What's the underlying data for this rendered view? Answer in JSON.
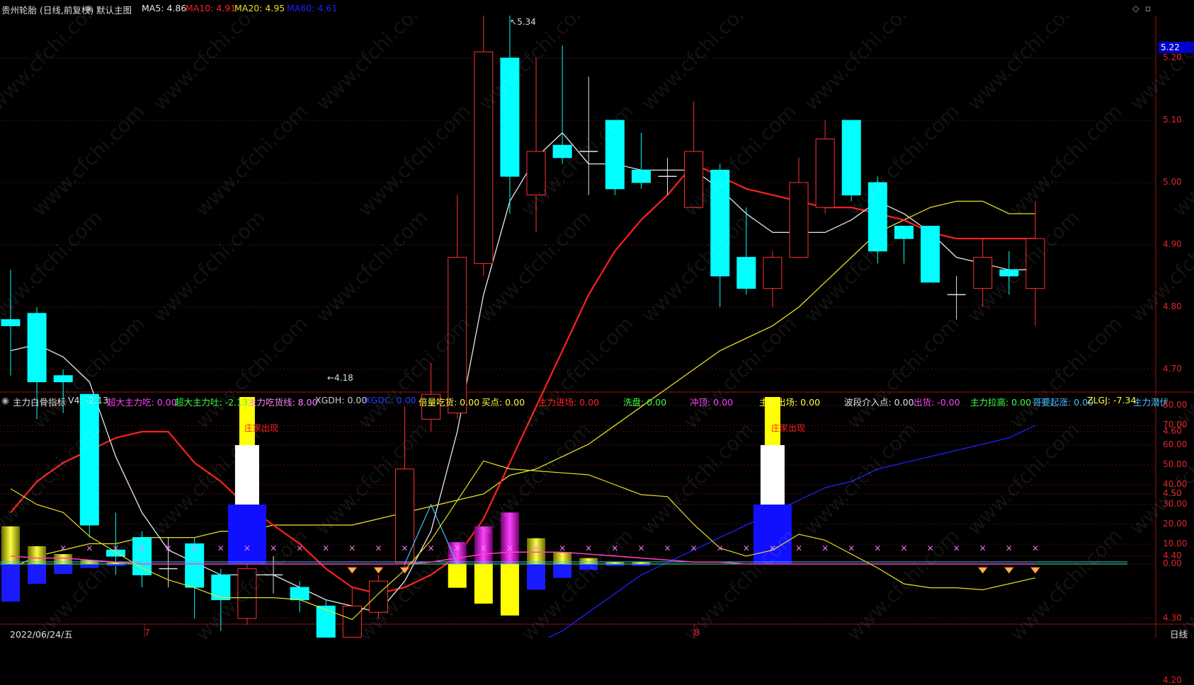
{
  "header": {
    "stock_title": "贵州轮胎 (日线,前复权)",
    "main_chart_label": "默认主图",
    "ma5_label": "MA5: 4.86",
    "ma10_label": "MA10: 4.91",
    "ma20_label": "MA20: 4.95",
    "ma60_label": "MA60: 4.61",
    "colors": {
      "ma5": "#e8e8e8",
      "ma10": "#ff2020",
      "ma20": "#e8e020",
      "ma60": "#2020ff"
    }
  },
  "price_axis": {
    "current_price": "5.22",
    "ticks": [
      "5.20",
      "5.10",
      "5.00",
      "4.90",
      "4.80",
      "4.70",
      "4.60",
      "4.50",
      "4.40",
      "4.30",
      "4.20"
    ]
  },
  "annotations": {
    "high_label": "5.34",
    "low_label": "←4.18"
  },
  "indicator": {
    "name": "主力白骨指标",
    "v4": "V4: -2.13",
    "items": [
      {
        "label": "超大主力吃: 0.00",
        "color": "#ff40ff"
      },
      {
        "label": "超大主力吐: -2.13",
        "color": "#40ff40"
      },
      {
        "label": "主力吃货线: 8.00",
        "color": "#ff80ff"
      },
      {
        "label": "XGDH: 0.00",
        "color": "#d0d0d0"
      },
      {
        "label": "XGDC: 0.00",
        "color": "#2040ff"
      },
      {
        "label": "倍量吃货: 0.00",
        "color": "#ffff40"
      },
      {
        "label": "买点: 0.00",
        "color": "#ffff40"
      },
      {
        "label": "主力进场: 0.00",
        "color": "#ff2020"
      },
      {
        "label": "洗盘: 0.00",
        "color": "#40ff40"
      },
      {
        "label": "冲顶: 0.00",
        "color": "#ff40ff"
      },
      {
        "label": "主力出场: 0.00",
        "color": "#ffff40"
      },
      {
        "label": "波段介入点: 0.00",
        "color": "#e0e0e0"
      },
      {
        "label": "出货: -0.00",
        "color": "#ff40ff"
      },
      {
        "label": "主力拉高: 0.00",
        "color": "#40ff40"
      },
      {
        "label": "哥要起涨: 0.00",
        "color": "#40c0ff"
      },
      {
        "label": "ZLGJ: -7.34",
        "color": "#ffff40"
      },
      {
        "label": "主力潜伏",
        "color": "#40c0ff"
      }
    ],
    "zj_label": "庄家出现",
    "axis_ticks": [
      "80.00",
      "70.00",
      "60.00",
      "50.00",
      "40.00",
      "30.00",
      "20.00",
      "10.00",
      "0.00"
    ]
  },
  "bottom_bar": {
    "date": "2022/06/24/五",
    "month_7": "7",
    "month_8": "8",
    "period": "日线"
  },
  "watermark": "www.cfchi.com",
  "chart_data": {
    "type": "candlestick",
    "candles": [
      {
        "o": 4.78,
        "c": 4.77,
        "h": 4.86,
        "l": 4.69
      },
      {
        "o": 4.79,
        "c": 4.68,
        "h": 4.8,
        "l": 4.62
      },
      {
        "o": 4.69,
        "c": 4.68,
        "h": 4.7,
        "l": 4.63
      },
      {
        "o": 4.66,
        "c": 4.45,
        "h": 4.66,
        "l": 4.43
      },
      {
        "o": 4.41,
        "c": 4.4,
        "h": 4.47,
        "l": 4.37
      },
      {
        "o": 4.43,
        "c": 4.37,
        "h": 4.44,
        "l": 4.35
      },
      {
        "o": 4.38,
        "c": 4.38,
        "h": 4.43,
        "l": 4.35
      },
      {
        "o": 4.42,
        "c": 4.35,
        "h": 4.43,
        "l": 4.3
      },
      {
        "o": 4.37,
        "c": 4.33,
        "h": 4.38,
        "l": 4.28
      },
      {
        "o": 4.3,
        "c": 4.38,
        "h": 4.42,
        "l": 4.29
      },
      {
        "o": 4.37,
        "c": 4.37,
        "h": 4.4,
        "l": 4.34
      },
      {
        "o": 4.35,
        "c": 4.33,
        "h": 4.36,
        "l": 4.31
      },
      {
        "o": 4.32,
        "c": 4.19,
        "h": 4.33,
        "l": 4.18
      },
      {
        "o": 4.27,
        "c": 4.32,
        "h": 4.35,
        "l": 4.22
      },
      {
        "o": 4.31,
        "c": 4.36,
        "h": 4.37,
        "l": 4.3
      },
      {
        "o": 4.39,
        "c": 4.54,
        "h": 4.64,
        "l": 4.38
      },
      {
        "o": 4.62,
        "c": 4.66,
        "h": 4.71,
        "l": 4.6
      },
      {
        "o": 4.63,
        "c": 4.88,
        "h": 4.98,
        "l": 4.62
      },
      {
        "o": 4.87,
        "c": 5.21,
        "h": 5.27,
        "l": 4.85
      },
      {
        "o": 5.2,
        "c": 5.01,
        "h": 5.34,
        "l": 4.95
      },
      {
        "o": 4.98,
        "c": 5.05,
        "h": 5.2,
        "l": 4.92
      },
      {
        "o": 5.06,
        "c": 5.04,
        "h": 5.22,
        "l": 5.03
      },
      {
        "o": 5.05,
        "c": 5.05,
        "h": 5.17,
        "l": 4.98
      },
      {
        "o": 5.1,
        "c": 4.99,
        "h": 5.1,
        "l": 4.98
      },
      {
        "o": 5.02,
        "c": 5.0,
        "h": 5.08,
        "l": 4.99
      },
      {
        "o": 5.01,
        "c": 5.01,
        "h": 5.04,
        "l": 4.98
      },
      {
        "o": 4.96,
        "c": 5.05,
        "h": 5.13,
        "l": 4.96
      },
      {
        "o": 5.02,
        "c": 4.85,
        "h": 5.03,
        "l": 4.8
      },
      {
        "o": 4.88,
        "c": 4.83,
        "h": 4.96,
        "l": 4.82
      },
      {
        "o": 4.83,
        "c": 4.88,
        "h": 4.89,
        "l": 4.8
      },
      {
        "o": 4.88,
        "c": 5.0,
        "h": 5.04,
        "l": 4.88
      },
      {
        "o": 4.96,
        "c": 5.07,
        "h": 5.1,
        "l": 4.95
      },
      {
        "o": 5.1,
        "c": 4.98,
        "h": 5.1,
        "l": 4.97
      },
      {
        "o": 5.0,
        "c": 4.89,
        "h": 5.01,
        "l": 4.87
      },
      {
        "o": 4.93,
        "c": 4.91,
        "h": 4.93,
        "l": 4.87
      },
      {
        "o": 4.93,
        "c": 4.84,
        "h": 4.93,
        "l": 4.84
      },
      {
        "o": 4.82,
        "c": 4.82,
        "h": 4.85,
        "l": 4.78
      },
      {
        "o": 4.83,
        "c": 4.88,
        "h": 4.91,
        "l": 4.8
      },
      {
        "o": 4.86,
        "c": 4.85,
        "h": 4.89,
        "l": 4.82
      },
      {
        "o": 4.83,
        "c": 4.91,
        "h": 4.97,
        "l": 4.77
      }
    ],
    "ma5": [
      4.73,
      4.74,
      4.72,
      4.68,
      4.56,
      4.47,
      4.41,
      4.39,
      4.37,
      4.37,
      4.37,
      4.35,
      4.33,
      4.32,
      4.31,
      4.36,
      4.44,
      4.6,
      4.82,
      4.97,
      5.04,
      5.08,
      5.03,
      5.03,
      5.02,
      5.02,
      5.02,
      4.99,
      4.95,
      4.92,
      4.92,
      4.92,
      4.94,
      4.97,
      4.95,
      4.92,
      4.88,
      4.87,
      4.86,
      4.86
    ],
    "ma10": [
      4.47,
      4.52,
      4.55,
      4.57,
      4.59,
      4.6,
      4.6,
      4.55,
      4.52,
      4.48,
      4.45,
      4.42,
      4.38,
      4.35,
      4.34,
      4.35,
      4.37,
      4.4,
      4.46,
      4.55,
      4.64,
      4.73,
      4.82,
      4.89,
      4.94,
      4.98,
      5.03,
      5.01,
      4.99,
      4.98,
      4.97,
      4.96,
      4.96,
      4.95,
      4.94,
      4.92,
      4.91,
      4.91,
      4.91,
      4.91
    ],
    "ma20": [
      4.38,
      4.4,
      4.41,
      4.42,
      4.42,
      4.43,
      4.43,
      4.43,
      4.44,
      4.44,
      4.45,
      4.45,
      4.45,
      4.45,
      4.46,
      4.47,
      4.48,
      4.49,
      4.5,
      4.53,
      4.54,
      4.56,
      4.58,
      4.61,
      4.64,
      4.67,
      4.7,
      4.73,
      4.75,
      4.77,
      4.8,
      4.84,
      4.88,
      4.92,
      4.94,
      4.96,
      4.97,
      4.97,
      4.95,
      4.95
    ],
    "ma60": [
      4.26,
      4.26,
      4.26,
      4.26,
      4.26,
      4.26,
      4.26,
      4.25,
      4.25,
      4.25,
      4.24,
      4.24,
      4.23,
      4.23,
      4.22,
      4.22,
      4.22,
      4.22,
      4.23,
      4.24,
      4.26,
      4.28,
      4.31,
      4.34,
      4.37,
      4.39,
      4.41,
      4.43,
      4.45,
      4.47,
      4.49,
      4.51,
      4.52,
      4.54,
      4.55,
      4.56,
      4.57,
      4.58,
      4.59,
      4.61
    ],
    "indicator_bars": [
      {
        "pos": 19,
        "neg": -19
      },
      {
        "pos": 9,
        "neg": -10
      },
      {
        "pos": 5,
        "neg": -5
      },
      {
        "pos": 2,
        "neg": -2
      },
      {
        "pos": 1,
        "neg": -1
      },
      {
        "pos": 0,
        "neg": 0
      },
      {
        "pos": 0,
        "neg": 0
      },
      {
        "pos": 0,
        "neg": 0
      },
      {
        "pos": 0,
        "neg": 0
      },
      {
        "pos": 0,
        "neg": 0
      },
      {
        "pos": 0,
        "neg": 0
      },
      {
        "pos": 0,
        "neg": 0
      },
      {
        "pos": 0,
        "neg": 0
      },
      {
        "pos": 0,
        "neg": 0
      },
      {
        "pos": 0,
        "neg": 0
      },
      {
        "pos": 0,
        "neg": 0
      },
      {
        "pos": 0,
        "neg": 0
      },
      {
        "pos": 11,
        "neg": -12
      },
      {
        "pos": 19,
        "neg": -20
      },
      {
        "pos": 26,
        "neg": -26
      },
      {
        "pos": 13,
        "neg": -13
      },
      {
        "pos": 6,
        "neg": -7
      },
      {
        "pos": 3,
        "neg": -3
      },
      {
        "pos": 1,
        "neg": -1
      },
      {
        "pos": 1,
        "neg": -1
      },
      {
        "pos": 0,
        "neg": 0
      },
      {
        "pos": 0,
        "neg": 0
      },
      {
        "pos": 0,
        "neg": 0
      },
      {
        "pos": 0,
        "neg": 0
      },
      {
        "pos": 0,
        "neg": 0
      },
      {
        "pos": 0,
        "neg": 0
      },
      {
        "pos": 0,
        "neg": 0
      },
      {
        "pos": 0,
        "neg": 0
      },
      {
        "pos": 0,
        "neg": 0
      },
      {
        "pos": 0,
        "neg": 0
      },
      {
        "pos": 0,
        "neg": 0
      },
      {
        "pos": 0,
        "neg": 0
      },
      {
        "pos": 0,
        "neg": 0
      },
      {
        "pos": 0,
        "neg": 0
      },
      {
        "pos": 0,
        "neg": 0
      }
    ],
    "zj_events": [
      {
        "index": 9
      },
      {
        "index": 29
      }
    ],
    "zlgj_line": [
      38,
      30,
      26,
      14,
      6,
      -2,
      -8,
      -12,
      -17,
      -17,
      -17,
      -18,
      -23,
      -28,
      -15,
      -3,
      12,
      32,
      52,
      48,
      47,
      46,
      45,
      40,
      35,
      34,
      20,
      8,
      4,
      7,
      15,
      12,
      5,
      -2,
      -10,
      -12,
      -12,
      -13,
      -10,
      -7
    ],
    "pink_line": [
      4,
      3,
      3,
      2,
      1,
      0,
      0,
      0,
      0,
      0,
      0,
      0,
      0,
      0,
      0,
      0,
      1,
      3,
      5,
      6,
      6,
      6,
      5,
      4,
      3,
      2,
      1,
      1,
      0,
      0,
      0,
      0,
      0,
      0,
      0,
      0,
      0,
      0,
      0,
      0
    ],
    "cyan_spike_index": 16,
    "diamond_indices": [
      13,
      14,
      15,
      37,
      38,
      39
    ],
    "colors": {
      "up": "#ff3030",
      "down": "#00ffff",
      "doji": "#e0e0e0"
    }
  }
}
